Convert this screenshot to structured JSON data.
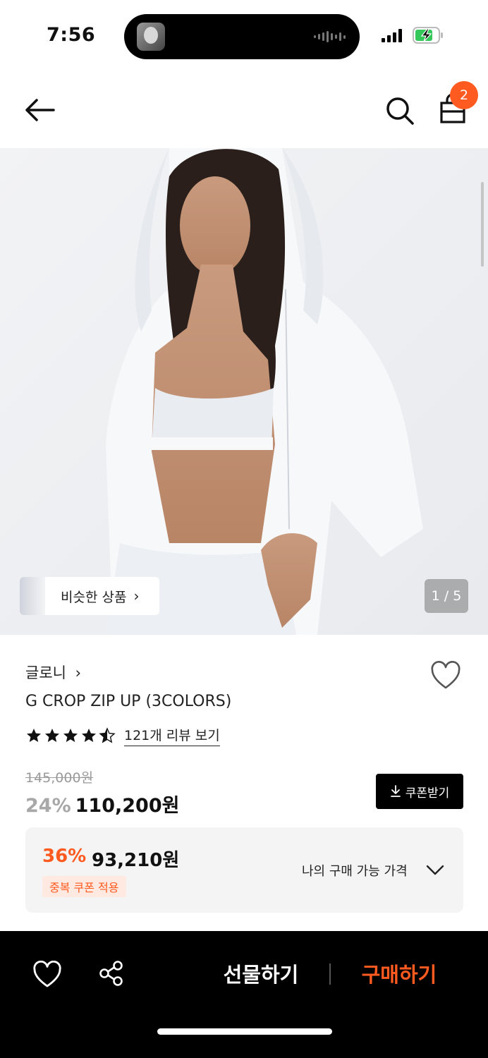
{
  "status_bar": {
    "time": "7:56",
    "icons": [
      "signal-icon",
      "battery-charging-icon"
    ]
  },
  "header": {
    "back_icon": "arrow-left-icon",
    "search_icon": "search-icon",
    "cart_icon": "shopping-bag-icon",
    "cart_count": "2"
  },
  "gallery": {
    "similar_label": "비슷한 상품",
    "page_indicator": "1 / 5"
  },
  "product": {
    "brand": "글로니",
    "brand_chevron": "›",
    "name": "G CROP ZIP UP (3COLORS)",
    "rating": 4.5,
    "review_link": "121개 리뷰 보기",
    "original_price": "145,000원",
    "discount_rate": "24%",
    "sale_price": "110,200원",
    "coupon_button": "쿠폰받기"
  },
  "best_price": {
    "rate": "36%",
    "price": "93,210원",
    "tag": "중복 쿠폰 적용",
    "my_price_label": "나의 구매 가능 가격"
  },
  "bottom_bar": {
    "gift_label": "선물하기",
    "buy_label": "구매하기"
  },
  "colors": {
    "accent": "#ff5a1f",
    "black": "#000000",
    "panel": "#f4f4f4"
  }
}
